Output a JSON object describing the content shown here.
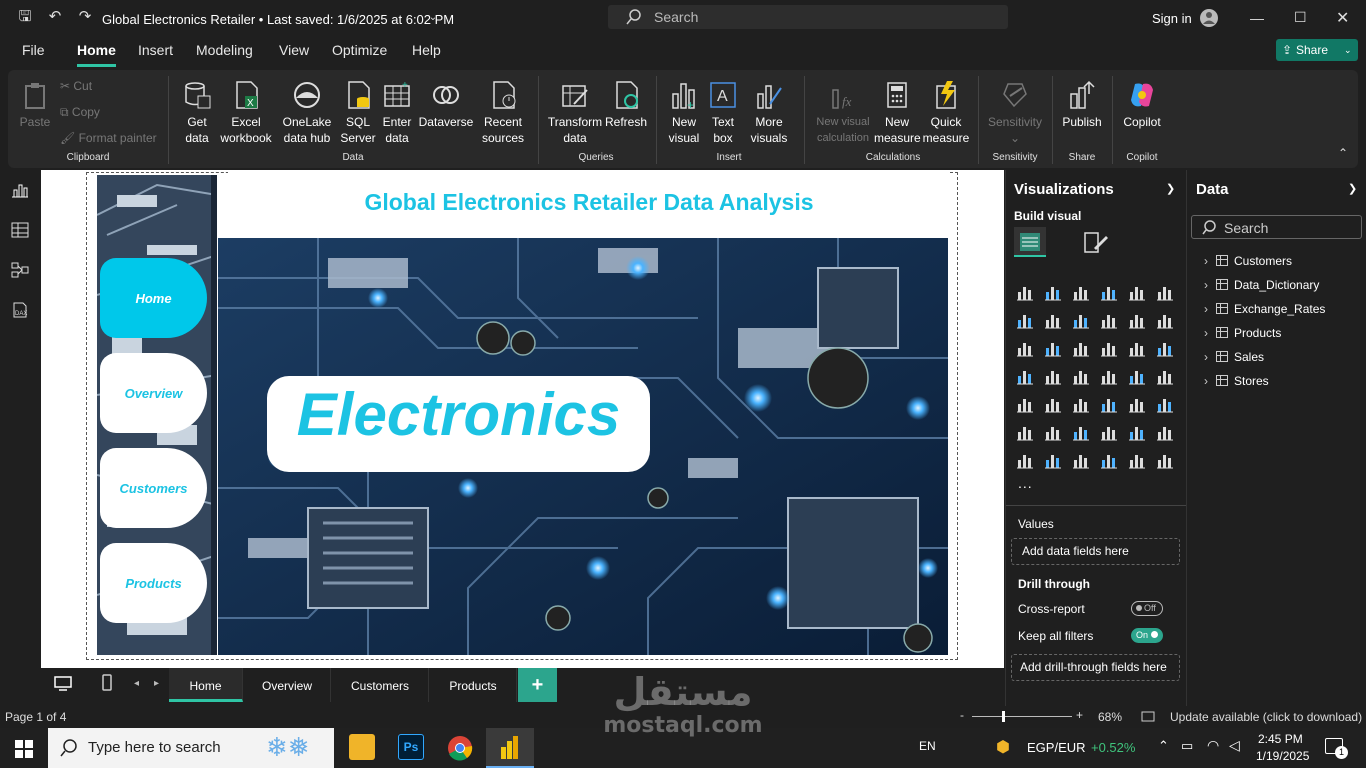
{
  "titlebar": {
    "doc_title": "Global Electronics Retailer • Last saved: 1/6/2025 at 6:02 PM",
    "search_placeholder": "Search",
    "sign_in": "Sign in"
  },
  "menu": {
    "items": [
      "File",
      "Home",
      "Insert",
      "Modeling",
      "View",
      "Optimize",
      "Help"
    ],
    "share": "Share"
  },
  "ribbon": {
    "clipboard": {
      "paste": "Paste",
      "cut": "Cut",
      "copy": "Copy",
      "format_painter": "Format painter",
      "label": "Clipboard"
    },
    "data": {
      "get_data": "Get data",
      "excel": "Excel workbook",
      "onelake": "OneLake data hub",
      "sql": "SQL Server",
      "enter": "Enter data",
      "dataverse": "Dataverse",
      "recent": "Recent sources",
      "label": "Data"
    },
    "queries": {
      "transform": "Transform data",
      "refresh": "Refresh",
      "label": "Queries"
    },
    "insert": {
      "new_visual": "New visual",
      "text_box": "Text box",
      "more_visuals": "More visuals",
      "label": "Insert"
    },
    "calculations": {
      "new_visual_calc": "New visual calculation",
      "new_measure": "New measure",
      "quick_measure": "Quick measure",
      "label": "Calculations"
    },
    "sensitivity": {
      "btn": "Sensitivity",
      "label": "Sensitivity"
    },
    "share": {
      "publish": "Publish",
      "label": "Share"
    },
    "copilot": {
      "btn": "Copilot",
      "label": "Copilot"
    }
  },
  "report": {
    "banner_title": "Global Electronics Retailer Data Analysis",
    "hero_text": "Electronics",
    "nav": [
      "Home",
      "Overview",
      "Customers",
      "Products"
    ]
  },
  "pages": {
    "tabs": [
      "Home",
      "Overview",
      "Customers",
      "Products"
    ],
    "add": "+"
  },
  "viz": {
    "title": "Visualizations",
    "build_visual": "Build visual",
    "values": "Values",
    "add_data_fields": "Add data fields here",
    "drill_through": "Drill through",
    "cross_report": "Cross-report",
    "cross_report_state": "Off",
    "keep_filters": "Keep all filters",
    "keep_filters_state": "On",
    "add_drill": "Add drill-through fields here",
    "more": "..."
  },
  "data_pane": {
    "title": "Data",
    "search_placeholder": "Search",
    "tables": [
      "Customers",
      "Data_Dictionary",
      "Exchange_Rates",
      "Products",
      "Sales",
      "Stores"
    ]
  },
  "status": {
    "page": "Page 1 of 4",
    "zoom": "68%",
    "update": "Update available (click to download)"
  },
  "taskbar": {
    "search": "Type here to search",
    "lang": "EN",
    "currency": "EGP/EUR",
    "change": "+0.52%",
    "time": "2:45 PM",
    "date": "1/19/2025",
    "notif": "1"
  },
  "watermark": {
    "arabic": "مستقل",
    "latin": "mostaql.com"
  },
  "colors": {
    "accent": "#2fc5a5",
    "brand_cyan": "#1cc3e3",
    "share_bg": "#117865"
  }
}
